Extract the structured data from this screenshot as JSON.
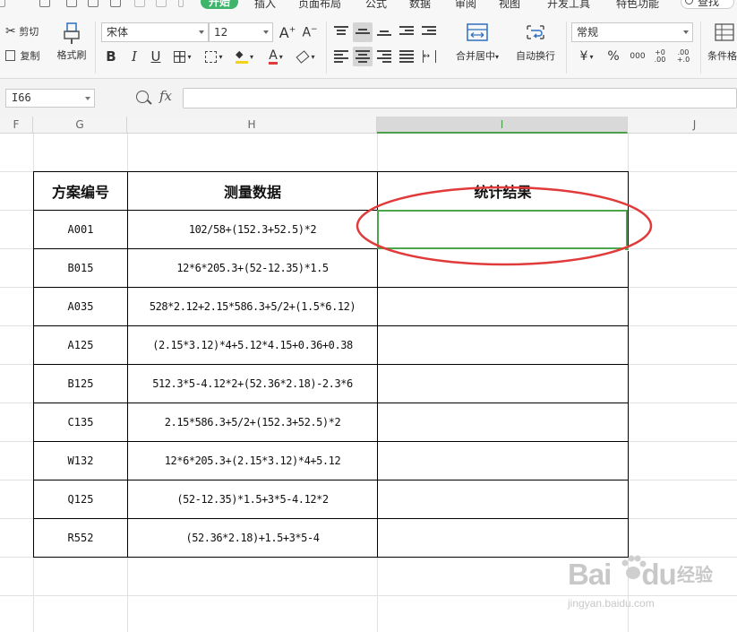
{
  "menu": {
    "items": [
      "开始",
      "插入",
      "页面布局",
      "公式",
      "数据",
      "审阅",
      "视图",
      "开发工具",
      "特色功能"
    ],
    "search": "查找"
  },
  "toolbar": {
    "cut": "剪切",
    "copy": "复制",
    "format_painter": "格式刷",
    "font_family": "宋体",
    "font_size": "12",
    "merge_center": "合并居中",
    "wrap_text": "自动换行",
    "number_format": "常规",
    "conditional_format": "条件格",
    "currency_symbol": "¥",
    "percent_symbol": "%",
    "thousands": "000",
    "inc_decimal": "+0 .00",
    "dec_decimal": ".00 +.0"
  },
  "formula_bar": {
    "cell_ref": "I66",
    "fx_label": "fx",
    "formula": ""
  },
  "columns": [
    "F",
    "G",
    "H",
    "I",
    "J"
  ],
  "active_column": "I",
  "table": {
    "headers": [
      "方案编号",
      "测量数据",
      "统计结果"
    ],
    "rows": [
      {
        "id": "A001",
        "data": "102/58+(152.3+52.5)*2",
        "result": ""
      },
      {
        "id": "B015",
        "data": "12*6*205.3+(52-12.35)*1.5",
        "result": ""
      },
      {
        "id": "A035",
        "data": "528*2.12+2.15*586.3+5/2+(1.5*6.12)",
        "result": ""
      },
      {
        "id": "A125",
        "data": "(2.15*3.12)*4+5.12*4.15+0.36+0.38",
        "result": ""
      },
      {
        "id": "B125",
        "data": "512.3*5-4.12*2+(52.36*2.18)-2.3*6",
        "result": ""
      },
      {
        "id": "C135",
        "data": "2.15*586.3+5/2+(152.3+52.5)*2",
        "result": ""
      },
      {
        "id": "W132",
        "data": "12*6*205.3+(2.15*3.12)*4+5.12",
        "result": ""
      },
      {
        "id": "Q125",
        "data": "(52-12.35)*1.5+3*5-4.12*2",
        "result": ""
      },
      {
        "id": "R552",
        "data": "(52.36*2.18)+1.5+3*5-4",
        "result": ""
      }
    ]
  },
  "watermark": {
    "brand_left": "Bai",
    "brand_right": "du",
    "jingyan": "经验",
    "url": "jingyan.baidu.com"
  },
  "colors": {
    "active_tab": "#3eb56b",
    "selection": "#4ca64c",
    "annotation": "#e03a3a"
  }
}
